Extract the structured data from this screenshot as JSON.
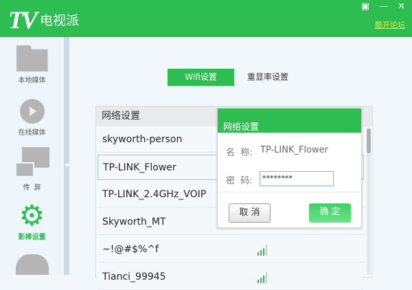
{
  "app": {
    "logo": "TV",
    "name": "电视派",
    "forum_link": "酷开论坛",
    "window_buttons": [
      "menu",
      "minimize",
      "close"
    ]
  },
  "sidebar": {
    "items": [
      {
        "label": "本地媒体",
        "icon": "folder-icon"
      },
      {
        "label": "在线媒体",
        "icon": "play-icon"
      },
      {
        "label": "传  屏",
        "icon": "screen-cast-icon"
      },
      {
        "label": "影棒设置",
        "icon": "gear-icon",
        "active": true
      },
      {
        "label": "",
        "icon": "cloud-upload-icon"
      }
    ]
  },
  "tabs": [
    {
      "label": "Wifi设置",
      "active": true
    },
    {
      "label": "重显率设置"
    }
  ],
  "network_list": {
    "header": "网络设置",
    "rows": [
      "skyworth-person",
      "TP-LINK_Flower",
      "TP-LINK_2.4GHz_VOIP",
      "Skyworth_MT",
      "~!@#$%^f",
      "Tianci_99945"
    ]
  },
  "dialog": {
    "title": "网络设置",
    "name_label": "名  称:",
    "name_value": "TP-LINK_Flower",
    "password_label": "密  码:",
    "password_value": "********",
    "cancel": "取 消",
    "ok": "确 定"
  },
  "colors": {
    "brand": "#2dbd50",
    "link": "#f5e23a"
  }
}
